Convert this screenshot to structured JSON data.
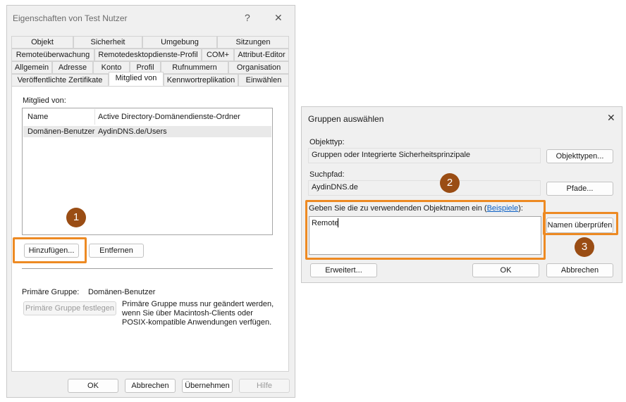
{
  "props": {
    "title": "Eigenschaften von Test Nutzer",
    "help": "?",
    "close": "✕",
    "tabs_row1": [
      "Objekt",
      "Sicherheit",
      "Umgebung",
      "Sitzungen"
    ],
    "tabs_row2": [
      "Remoteüberwachung",
      "Remotedesktopdienste-Profil",
      "COM+",
      "Attribut-Editor"
    ],
    "tabs_row3": [
      "Allgemein",
      "Adresse",
      "Konto",
      "Profil",
      "Rufnummern",
      "Organisation"
    ],
    "tabs_row4": [
      "Veröffentlichte Zertifikate",
      "Mitglied von",
      "Kennwortreplikation",
      "Einwählen"
    ],
    "member_of_label": "Mitglied von:",
    "col_name": "Name",
    "col_folder": "Active Directory-Domänendienste-Ordner",
    "rows": [
      {
        "name": "Domänen-Benutzer",
        "folder": "AydinDNS.de/Users"
      }
    ],
    "add_button": "Hinzufügen...",
    "remove_button": "Entfernen",
    "primary_group_label": "Primäre Gruppe:",
    "primary_group_value": "Domänen-Benutzer",
    "set_primary_button": "Primäre Gruppe festlegen",
    "primary_note_1": "Primäre Gruppe muss nur geändert werden,",
    "primary_note_2": "wenn Sie über Macintosh-Clients oder",
    "primary_note_3": "POSIX-kompatible Anwendungen verfügen.",
    "ok": "OK",
    "cancel": "Abbrechen",
    "apply": "Übernehmen",
    "help_button": "Hilfe"
  },
  "select": {
    "title": "Gruppen auswählen",
    "close": "✕",
    "objtype_label": "Objekttyp:",
    "objtype_value": "Gruppen oder Integrierte Sicherheitsprinzipale",
    "objtype_button": "Objekttypen...",
    "path_label": "Suchpfad:",
    "path_value": "AydinDNS.de",
    "path_button": "Pfade...",
    "names_label_prefix": "Geben Sie die zu verwendenden Objektnamen ein (",
    "names_label_link": "Beispiele",
    "names_label_suffix": "):",
    "names_value": "Remote",
    "check_names_button": "Namen überprüfen",
    "advanced_button": "Erweitert...",
    "ok": "OK",
    "cancel": "Abbrechen"
  },
  "badges": [
    "1",
    "2",
    "3"
  ],
  "colors": {
    "highlight": "#ed8a23",
    "badge": "#9a4d14",
    "link": "#0b5fc4"
  }
}
